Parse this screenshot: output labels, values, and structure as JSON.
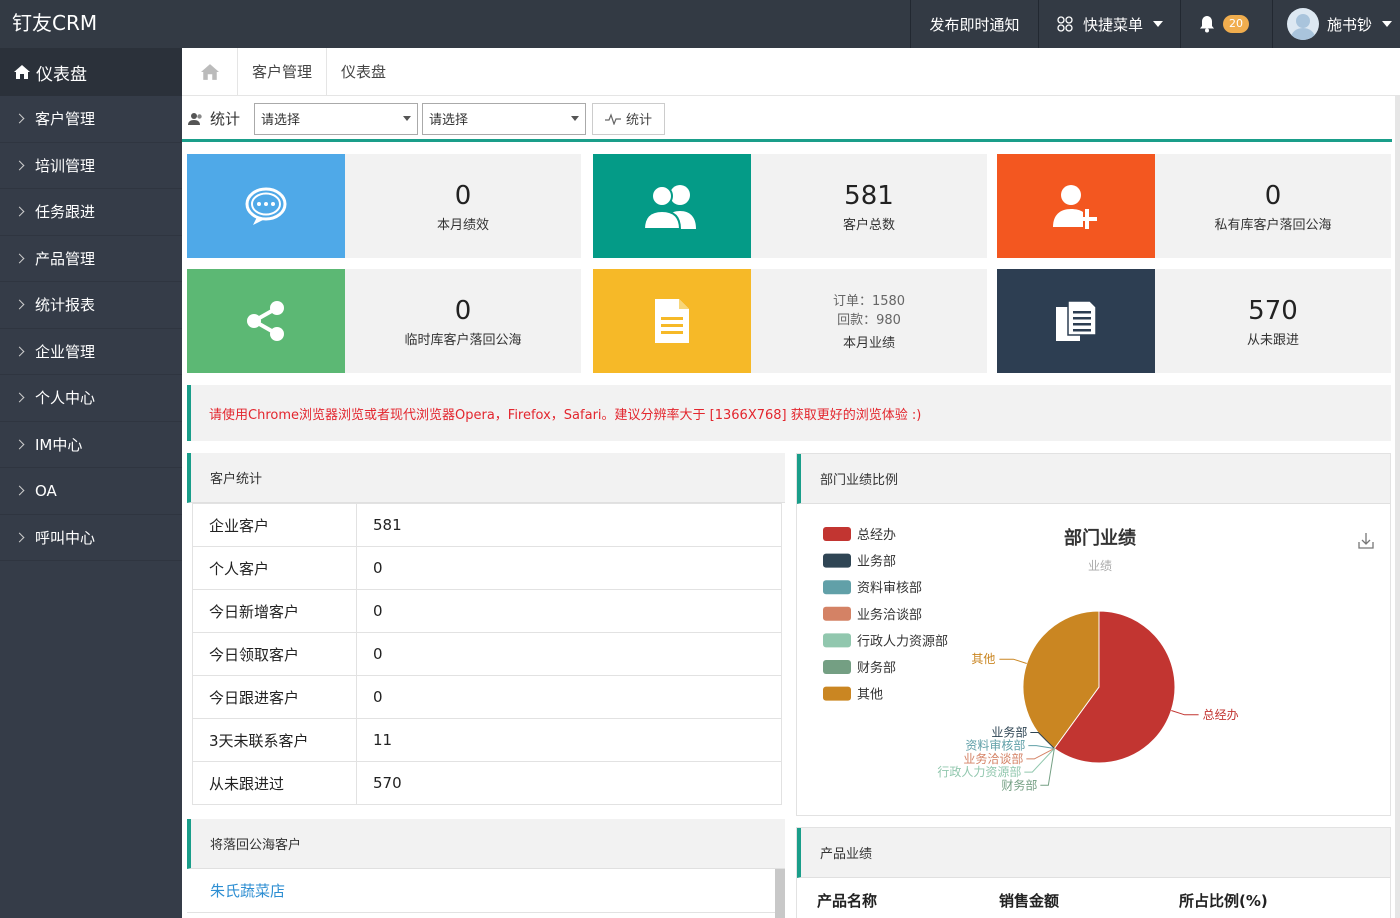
{
  "app": {
    "brand": "钉友CRM"
  },
  "topnav": {
    "notice": "发布即时通知",
    "menu": "快捷菜单",
    "bell_count": "20",
    "user": "施书钞"
  },
  "sidebar": {
    "head": "仪表盘",
    "items": [
      "客户管理",
      "培训管理",
      "任务跟进",
      "产品管理",
      "统计报表",
      "企业管理",
      "个人中心",
      "IM中心",
      "OA",
      "呼叫中心"
    ]
  },
  "breadcrumb": [
    "客户管理",
    "仪表盘"
  ],
  "filter": {
    "label": "统计",
    "select1": "请选择",
    "select2": "请选择",
    "button": "统计"
  },
  "cards": [
    {
      "value": "0",
      "label": "本月绩效",
      "color": "#4fa9e8",
      "icon": "chat-icon"
    },
    {
      "value": "581",
      "label": "客户总数",
      "color": "#049b87",
      "icon": "users-icon"
    },
    {
      "value": "0",
      "label": "私有库客户落回公海",
      "color": "#f35720",
      "icon": "user-add-icon"
    },
    {
      "value": "0",
      "label": "临时库客户落回公海",
      "color": "#5cb874",
      "icon": "share-icon"
    },
    {
      "order_line": "订单：1580",
      "payment_line": "回款：980",
      "label": "本月业绩",
      "color": "#f6b928",
      "icon": "document-icon"
    },
    {
      "value": "570",
      "label": "从未跟进",
      "color": "#2d3e52",
      "icon": "files-icon"
    }
  ],
  "alert": "请使用Chrome浏览器浏览或者现代浏览器Opera，Firefox，Safari。建议分辨率大于 [1366X768] 获取更好的浏览体验 :)",
  "customer_stats": {
    "title": "客户统计",
    "rows": [
      {
        "k": "企业客户",
        "v": "581"
      },
      {
        "k": "个人客户",
        "v": "0"
      },
      {
        "k": "今日新增客户",
        "v": "0"
      },
      {
        "k": "今日领取客户",
        "v": "0"
      },
      {
        "k": "今日跟进客户",
        "v": "0"
      },
      {
        "k": "3天未联系客户",
        "v": "11"
      },
      {
        "k": "从未跟进过",
        "v": "570"
      }
    ]
  },
  "falling_customers": {
    "title": "将落回公海客户",
    "first": "朱氏蔬菜店"
  },
  "dept_panel": {
    "title": "部门业绩比例"
  },
  "product_panel": {
    "title": "产品业绩",
    "cols": [
      "产品名称",
      "销售金额",
      "所占比例(%)"
    ]
  },
  "chart_data": {
    "type": "pie",
    "title": "部门业绩",
    "subtitle": "业绩",
    "legend_position": "top-left",
    "categories": [
      "总经办",
      "业务部",
      "资料审核部",
      "业务洽谈部",
      "行政人力资源部",
      "财务部",
      "其他"
    ],
    "values": [
      60,
      0,
      0,
      0,
      0,
      0,
      40
    ],
    "colors": [
      "#c23531",
      "#2f4554",
      "#61a0a8",
      "#d48265",
      "#91c7ae",
      "#749f83",
      "#ca8622"
    ]
  }
}
